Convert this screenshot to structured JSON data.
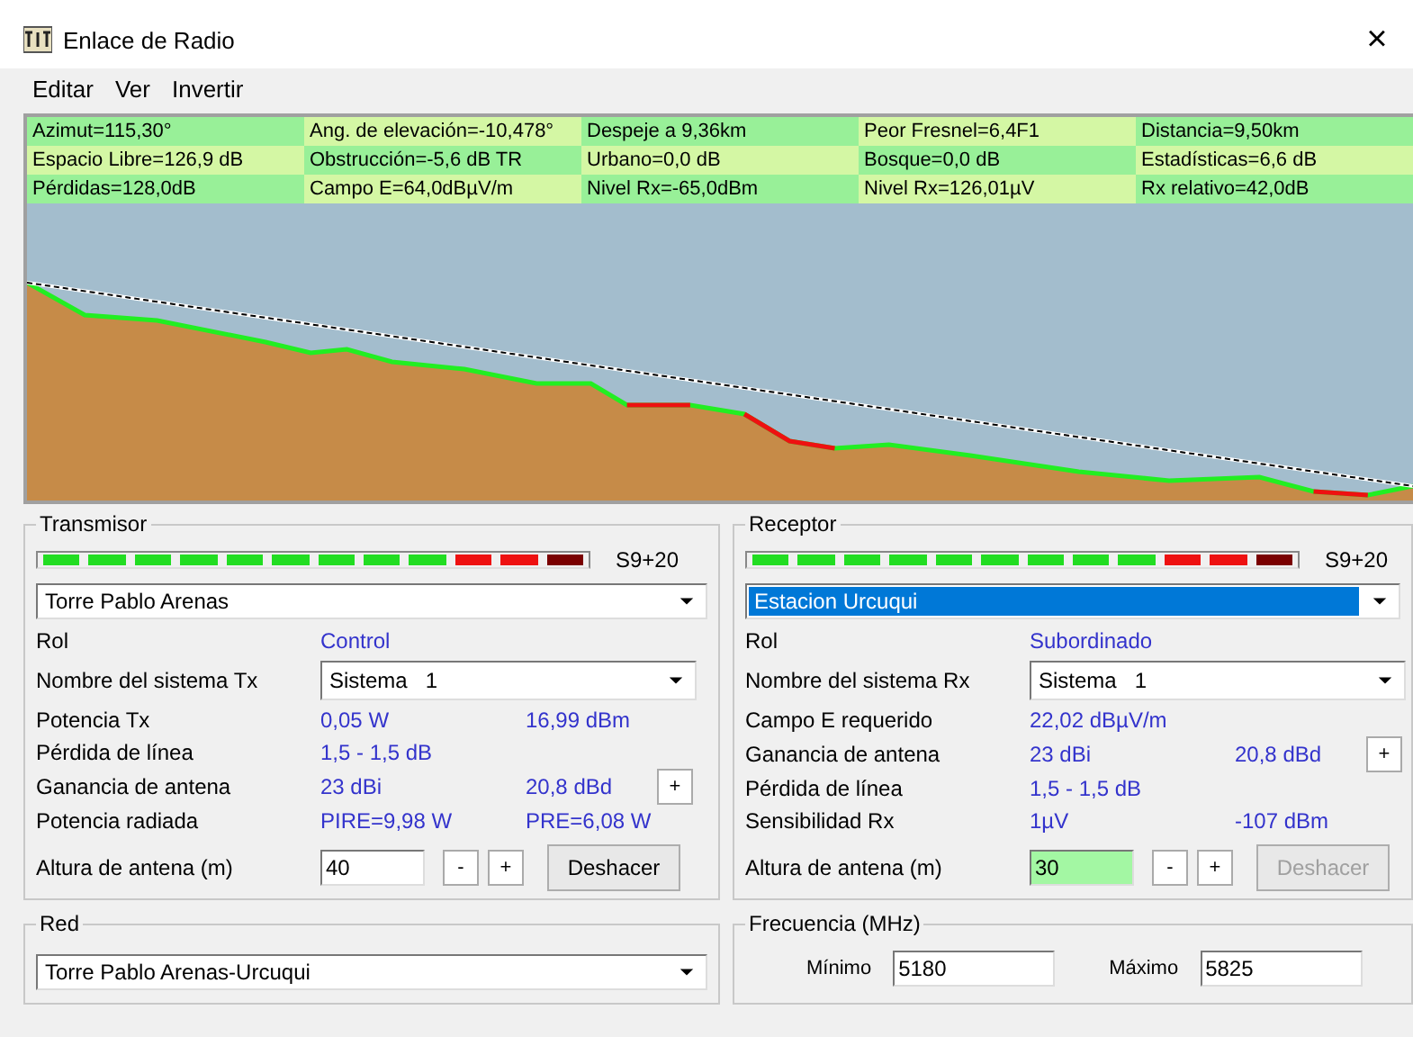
{
  "window": {
    "title": "Enlace de Radio",
    "close": "×"
  },
  "menu": [
    "Editar",
    "Ver",
    "Invertir"
  ],
  "summary": [
    [
      "Azimut=115,30°",
      "Ang. de elevación=-10,478°",
      "Despeje a 9,36km",
      "Peor Fresnel=6,4F1",
      "Distancia=9,50km"
    ],
    [
      "Espacio Libre=126,9 dB",
      "Obstrucción=-5,6 dB TR",
      "Urbano=0,0 dB",
      "Bosque=0,0 dB",
      "Estadísticas=6,6 dB"
    ],
    [
      "Pérdidas=128,0dB",
      "Campo E=64,0dBµV/m",
      "Nivel Rx=-65,0dBm",
      "Nivel Rx=126,01µV",
      "Rx relativo=42,0dB"
    ]
  ],
  "transmitter": {
    "title": "Transmisor",
    "meter": {
      "level": 1,
      "reading": "S9+20"
    },
    "station": {
      "value": "Torre Pablo Arenas",
      "selected": false
    },
    "rows": [
      {
        "kind": "text",
        "label": "Rol",
        "value": "Control"
      },
      {
        "kind": "select",
        "label": "Nombre del sistema Tx",
        "value": "Sistema   1"
      },
      {
        "kind": "pair",
        "label": "Potencia Tx",
        "value": "0,05 W",
        "value2": "16,99 dBm"
      },
      {
        "kind": "text",
        "label": "Pérdida de línea",
        "value": "1,5 - 1,5 dB"
      },
      {
        "kind": "pair",
        "label": "Ganancia de antena",
        "value": "23 dBi",
        "value2": "20,8 dBd",
        "button": "+"
      },
      {
        "kind": "pair",
        "label": "Potencia radiada",
        "value": "PIRE=9,98 W",
        "value2": "PRE=6,08 W"
      }
    ],
    "height": {
      "label": "Altura de antena (m)",
      "value": "40",
      "modified": false,
      "minus": "-",
      "plus": "+",
      "undo": "Deshacer",
      "undo_disabled": false
    }
  },
  "receiver": {
    "title": "Receptor",
    "meter": {
      "level": 1,
      "reading": "S9+20"
    },
    "station": {
      "value": "Estacion Urcuqui",
      "selected": true
    },
    "rows": [
      {
        "kind": "text",
        "label": "Rol",
        "value": "Subordinado"
      },
      {
        "kind": "select",
        "label": "Nombre del sistema Rx",
        "value": "Sistema   1"
      },
      {
        "kind": "text",
        "label": "Campo E requerido",
        "value": "22,02 dBµV/m"
      },
      {
        "kind": "pair",
        "label": "Ganancia de antena",
        "value": "23 dBi",
        "value2": "20,8 dBd",
        "button": "+"
      },
      {
        "kind": "text",
        "label": "Pérdida de línea",
        "value": "1,5 - 1,5 dB"
      },
      {
        "kind": "pair",
        "label": "Sensibilidad Rx",
        "value": "1µV",
        "value2": "-107 dBm"
      }
    ],
    "height": {
      "label": "Altura de antena (m)",
      "value": "30",
      "modified": true,
      "minus": "-",
      "plus": "+",
      "undo": "Deshacer",
      "undo_disabled": true
    }
  },
  "network": {
    "title": "Red",
    "value": "Torre Pablo Arenas-Urcuqui"
  },
  "frequency": {
    "title": "Frecuencia (MHz)",
    "min_label": "Mínimo",
    "min": "5180",
    "max_label": "Máximo",
    "max": "5825"
  }
}
